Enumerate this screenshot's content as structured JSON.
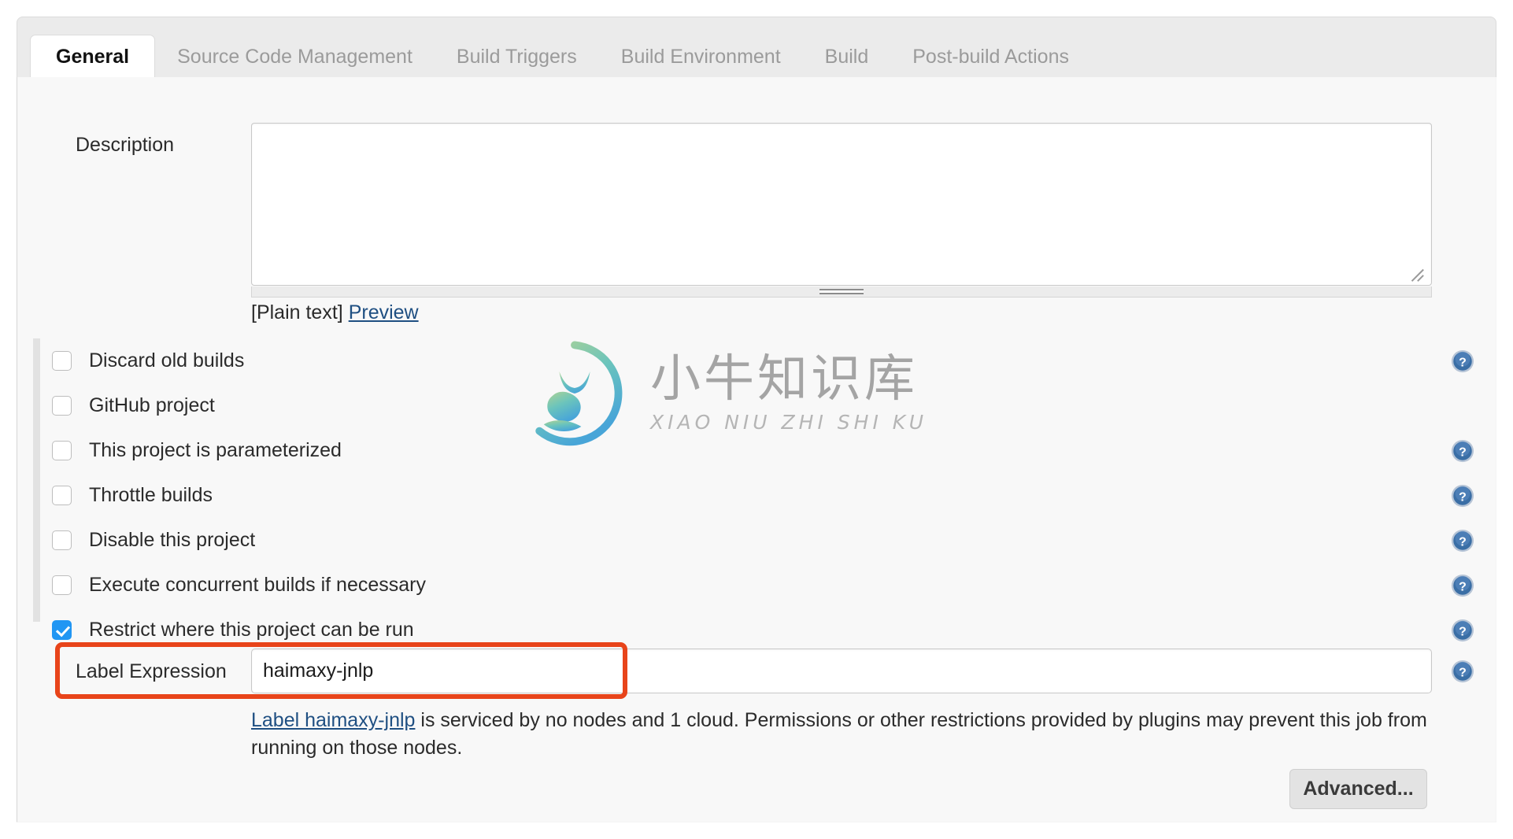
{
  "tabs": [
    {
      "label": "General",
      "active": true
    },
    {
      "label": "Source Code Management",
      "active": false
    },
    {
      "label": "Build Triggers",
      "active": false
    },
    {
      "label": "Build Environment",
      "active": false
    },
    {
      "label": "Build",
      "active": false
    },
    {
      "label": "Post-build Actions",
      "active": false
    }
  ],
  "description": {
    "label": "Description",
    "value": "",
    "markup_note": "[Plain text]",
    "preview_link": "Preview"
  },
  "options": [
    {
      "label": "Discard old builds",
      "checked": false,
      "help": true
    },
    {
      "label": "GitHub project",
      "checked": false,
      "help": false
    },
    {
      "label": "This project is parameterized",
      "checked": false,
      "help": true
    },
    {
      "label": "Throttle builds",
      "checked": false,
      "help": true
    },
    {
      "label": "Disable this project",
      "checked": false,
      "help": true
    },
    {
      "label": "Execute concurrent builds if necessary",
      "checked": false,
      "help": true
    },
    {
      "label": "Restrict where this project can be run",
      "checked": true,
      "help": true
    }
  ],
  "label_expression": {
    "label": "Label Expression",
    "value": "haimaxy-jnlp",
    "help": true,
    "highlight_color": "#e8441a"
  },
  "label_help_text": {
    "link": "Label haimaxy-jnlp",
    "rest": " is serviced by no nodes and 1 cloud. Permissions or other restrictions provided by plugins may prevent this job from running on those nodes."
  },
  "advanced_button": "Advanced...",
  "watermark": {
    "cn": "小牛知识库",
    "en": "XIAO NIU ZHI SHI KU"
  },
  "colors": {
    "accent_checkbox": "#2196f3",
    "link": "#1f4f82",
    "highlight": "#e8441a",
    "help_icon": "#3a6ea5"
  }
}
